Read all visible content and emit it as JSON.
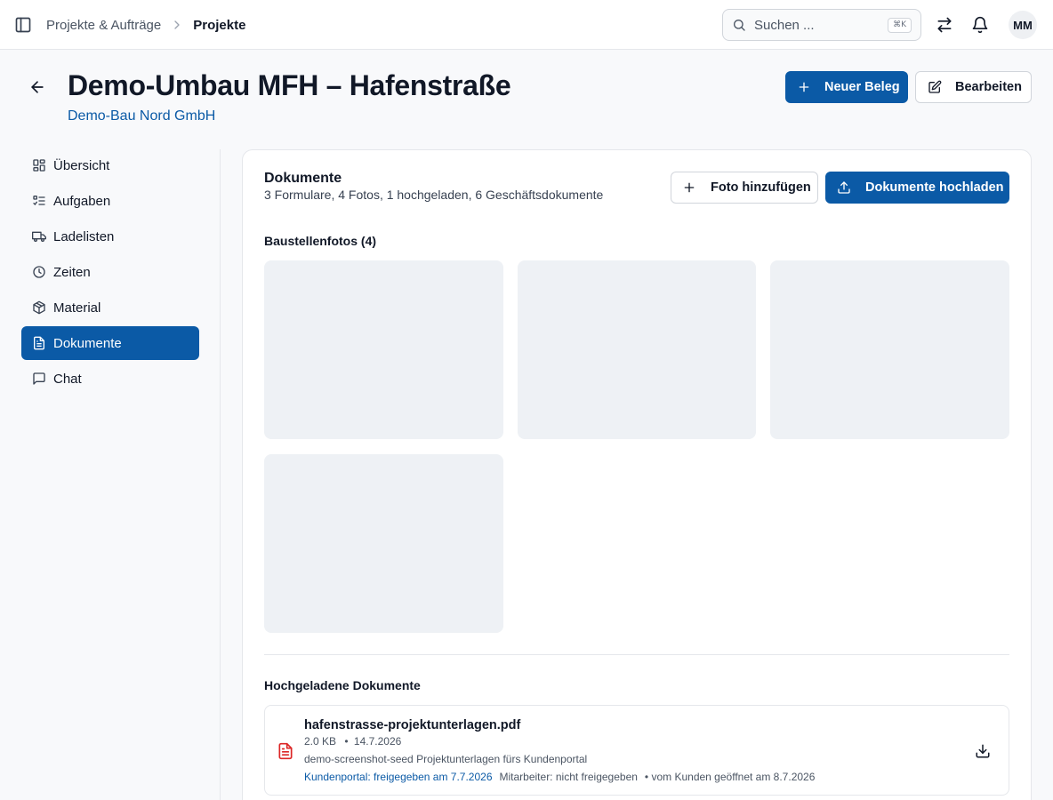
{
  "topbar": {
    "breadcrumb": {
      "parent": "Projekte & Aufträge",
      "current": "Projekte"
    },
    "search": {
      "placeholder": "Suchen ...",
      "shortcut": "⌘K"
    },
    "avatar_initials": "MM"
  },
  "header": {
    "title": "Demo-Umbau MFH – Hafenstraße",
    "customer": "Demo-Bau Nord GmbH",
    "new_receipt_label": "Neuer Beleg",
    "edit_label": "Bearbeiten"
  },
  "sidebar": {
    "items": [
      {
        "label": "Übersicht",
        "icon": "overview-icon",
        "active": false
      },
      {
        "label": "Aufgaben",
        "icon": "tasks-icon",
        "active": false
      },
      {
        "label": "Ladelisten",
        "icon": "truck-icon",
        "active": false
      },
      {
        "label": "Zeiten",
        "icon": "clock-icon",
        "active": false
      },
      {
        "label": "Material",
        "icon": "package-icon",
        "active": false
      },
      {
        "label": "Dokumente",
        "icon": "document-icon",
        "active": true
      },
      {
        "label": "Chat",
        "icon": "chat-icon",
        "active": false
      }
    ]
  },
  "documents": {
    "title": "Dokumente",
    "summary": "3 Formulare, 4 Fotos, 1 hochgeladen, 6 Geschäftsdokumente",
    "add_photo_label": "Foto hinzufügen",
    "upload_label": "Dokumente hochladen",
    "photos_heading": "Baustellenfotos (4)",
    "photo_count": 4,
    "uploaded_heading": "Hochgeladene Dokumente",
    "files": [
      {
        "name": "hafenstrasse-projektunterlagen.pdf",
        "size": "2.0 KB",
        "date": "14.7.2026",
        "description": "demo-screenshot-seed Projektunterlagen fürs Kundenportal",
        "portal_status": "Kundenportal: freigegeben am 7.7.2026",
        "staff_status": "Mitarbeiter: nicht freigegeben",
        "opened_status": "vom Kunden geöffnet am 8.7.2026"
      }
    ]
  },
  "colors": {
    "primary": "#0b5aa6",
    "pdf_icon": "#dc2626",
    "photo_placeholder": "#eef1f5"
  }
}
